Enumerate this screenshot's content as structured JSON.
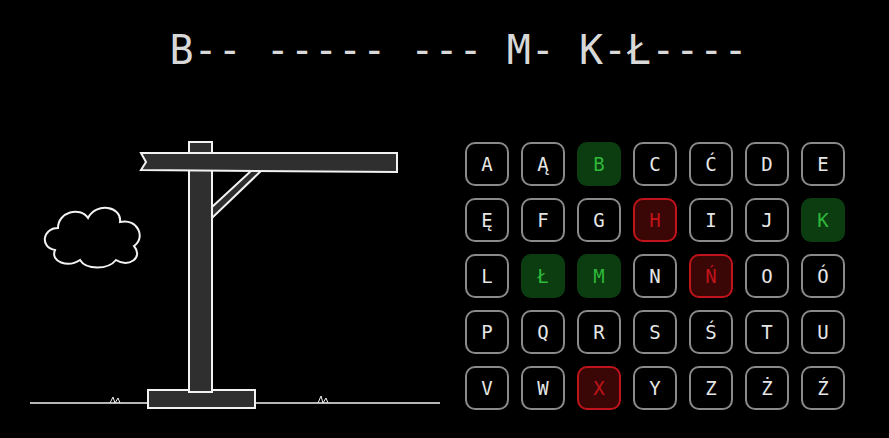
{
  "puzzle": {
    "text": "B-- ----- --- M- K-Ł----"
  },
  "keyboard": [
    {
      "label": "A",
      "kind": "open"
    },
    {
      "label": "Ą",
      "kind": "open"
    },
    {
      "label": "B",
      "kind": "hit"
    },
    {
      "label": "C",
      "kind": "open"
    },
    {
      "label": "Ć",
      "kind": "open"
    },
    {
      "label": "D",
      "kind": "open"
    },
    {
      "label": "E",
      "kind": "open"
    },
    {
      "label": "Ę",
      "kind": "open"
    },
    {
      "label": "F",
      "kind": "open"
    },
    {
      "label": "G",
      "kind": "open"
    },
    {
      "label": "H",
      "kind": "miss"
    },
    {
      "label": "I",
      "kind": "open"
    },
    {
      "label": "J",
      "kind": "open"
    },
    {
      "label": "K",
      "kind": "hit"
    },
    {
      "label": "L",
      "kind": "open"
    },
    {
      "label": "Ł",
      "kind": "hit"
    },
    {
      "label": "M",
      "kind": "hit"
    },
    {
      "label": "N",
      "kind": "open"
    },
    {
      "label": "Ń",
      "kind": "miss"
    },
    {
      "label": "O",
      "kind": "open"
    },
    {
      "label": "Ó",
      "kind": "open"
    },
    {
      "label": "P",
      "kind": "open"
    },
    {
      "label": "Q",
      "kind": "open"
    },
    {
      "label": "R",
      "kind": "open"
    },
    {
      "label": "S",
      "kind": "open"
    },
    {
      "label": "Ś",
      "kind": "open"
    },
    {
      "label": "T",
      "kind": "open"
    },
    {
      "label": "U",
      "kind": "open"
    },
    {
      "label": "V",
      "kind": "open"
    },
    {
      "label": "W",
      "kind": "open"
    },
    {
      "label": "X",
      "kind": "miss"
    },
    {
      "label": "Y",
      "kind": "open"
    },
    {
      "label": "Z",
      "kind": "open"
    },
    {
      "label": "Ż",
      "kind": "open"
    },
    {
      "label": "Ź",
      "kind": "open"
    }
  ]
}
